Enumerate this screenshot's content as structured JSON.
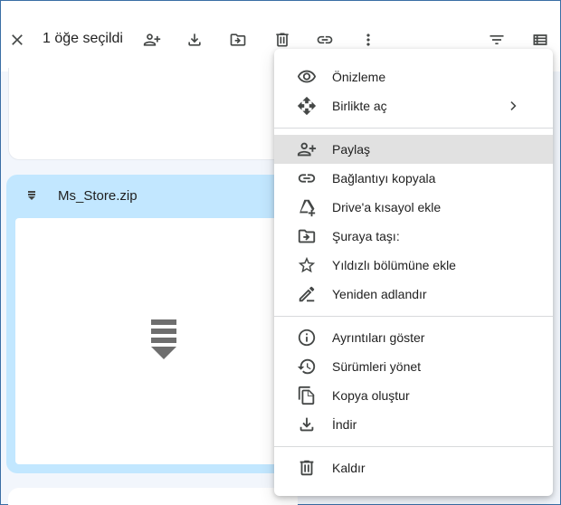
{
  "toolbar": {
    "selection_text": "1 öğe seçildi",
    "icons": [
      "close-icon",
      "add-person-icon",
      "download-icon",
      "move-to-folder-icon",
      "trash-icon",
      "link-icon",
      "more-vert-icon",
      "filter-icon",
      "list-view-icon"
    ]
  },
  "file": {
    "name": "Ms_Store.zip",
    "type_icon": "zip-icon"
  },
  "context_menu": {
    "items": [
      {
        "label": "Önizleme",
        "icon": "eye-icon"
      },
      {
        "label": "Birlikte aç",
        "icon": "open-with-icon",
        "submenu": true
      },
      {
        "label": "Paylaş",
        "icon": "add-person-icon",
        "highlighted": true
      },
      {
        "label": "Bağlantıyı kopyala",
        "icon": "link-icon"
      },
      {
        "label": "Drive'a kısayol ekle",
        "icon": "drive-shortcut-icon"
      },
      {
        "label": "Şuraya taşı:",
        "icon": "move-to-folder-icon"
      },
      {
        "label": "Yıldızlı bölümüne ekle",
        "icon": "star-icon"
      },
      {
        "label": "Yeniden adlandır",
        "icon": "rename-pencil-icon"
      },
      {
        "label": "Ayrıntıları göster",
        "icon": "info-icon"
      },
      {
        "label": "Sürümleri yönet",
        "icon": "history-icon"
      },
      {
        "label": "Kopya oluştur",
        "icon": "copy-icon"
      },
      {
        "label": "İndir",
        "icon": "download-icon"
      },
      {
        "label": "Kaldır",
        "icon": "trash-icon"
      }
    ]
  },
  "colors": {
    "selected_card": "#c2e7ff",
    "menu_highlight": "#e1e1e1",
    "icon": "#444746",
    "background": "#f2f6fc"
  }
}
